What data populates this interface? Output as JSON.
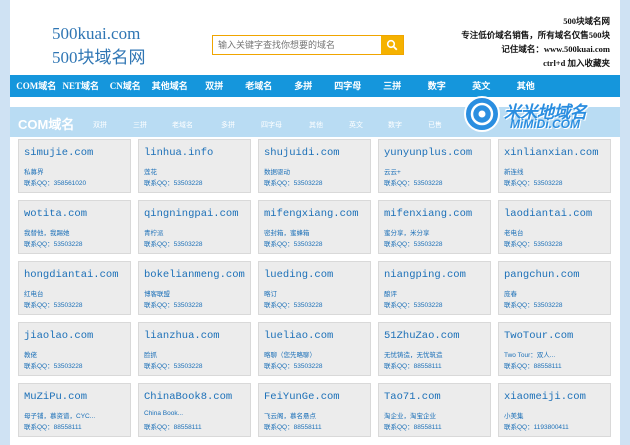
{
  "header": {
    "logo_en": "500kuai.com",
    "logo_cn": "500块域名网",
    "search_placeholder": "输入关键字查找你想要的域名",
    "info_lines": [
      "500块域名网",
      "专注低价域名销售，所有域名仅售500块",
      "记住域名：www.500kuai.com",
      "ctrl+d 加入收藏夹"
    ]
  },
  "nav": [
    "COM域名",
    "NET域名",
    "CN域名",
    "其他域名",
    "双拼",
    "老域名",
    "多拼",
    "四字母",
    "三拼",
    "数字",
    "英文",
    "其他"
  ],
  "category": {
    "title": "COM域名",
    "links": [
      "双拼",
      "三拼",
      "老域名",
      "多拼",
      "四字母",
      "其他",
      "英文",
      "数字",
      "已售"
    ]
  },
  "watermark": {
    "cn": "米米地域名",
    "en": "MiMiDi.COM"
  },
  "domains": [
    {
      "name": "simujie.com",
      "desc": "私募界",
      "qq": "联系QQ：358561020"
    },
    {
      "name": "linhua.info",
      "desc": "莲花",
      "qq": "联系QQ：53503228"
    },
    {
      "name": "shujuidi.com",
      "desc": "数据驱动",
      "qq": "联系QQ：53503228"
    },
    {
      "name": "yunyunplus.com",
      "desc": "云云+",
      "qq": "联系QQ：53503228"
    },
    {
      "name": "xinlianxian.com",
      "desc": "新连线",
      "qq": "联系QQ：53503228"
    },
    {
      "name": "wotita.com",
      "desc": "我替他，我踢她",
      "qq": "联系QQ：53503228"
    },
    {
      "name": "qingningpai.com",
      "desc": "青柠派",
      "qq": "联系QQ：53503228"
    },
    {
      "name": "mifengxiang.com",
      "desc": "密封箱，蜜蜂箱",
      "qq": "联系QQ：53503228"
    },
    {
      "name": "mifenxiang.com",
      "desc": "蜜分享，米分享",
      "qq": "联系QQ：53503228"
    },
    {
      "name": "laodiantai.com",
      "desc": "老电台",
      "qq": "联系QQ：53503228"
    },
    {
      "name": "hongdiantai.com",
      "desc": "红电台",
      "qq": "联系QQ：53503228"
    },
    {
      "name": "bokelianmeng.com",
      "desc": "博客联盟",
      "qq": "联系QQ：53503228"
    },
    {
      "name": "lueding.com",
      "desc": "略订",
      "qq": "联系QQ：53503228"
    },
    {
      "name": "niangping.com",
      "desc": "酿评",
      "qq": "联系QQ：53503228"
    },
    {
      "name": "pangchun.com",
      "desc": "庞春",
      "qq": "联系QQ：53503228"
    },
    {
      "name": "jiaolao.com",
      "desc": "教佬",
      "qq": "联系QQ：53503228"
    },
    {
      "name": "lianzhua.com",
      "desc": "脸抓",
      "qq": "联系QQ：53503228"
    },
    {
      "name": "lueliao.com",
      "desc": "略聊（您先略聊）",
      "qq": "联系QQ：53503228"
    },
    {
      "name": "51ZhuZao.com",
      "desc": "无忧铸造，无忧筑造",
      "qq": "联系QQ：88558111"
    },
    {
      "name": "TwoTour.com",
      "desc": "Two Tour：双人...",
      "qq": "联系QQ：88558111"
    },
    {
      "name": "MuZiPu.com",
      "desc": "母子铺，慕资谱，CYC...",
      "qq": "联系QQ：88558111"
    },
    {
      "name": "ChinaBook8.com",
      "desc": "China Book...",
      "qq": "联系QQ：88558111"
    },
    {
      "name": "FeiYunGe.com",
      "desc": "飞云阁，慕名悬点",
      "qq": "联系QQ：88558111"
    },
    {
      "name": "Tao71.com",
      "desc": "淘企业，淘宝企业",
      "qq": "联系QQ：88558111"
    },
    {
      "name": "xiaomeiji.com",
      "desc": "小美集",
      "qq": "联系QQ：1193800411"
    }
  ],
  "colors": {
    "nav_bg": "#1596dc",
    "link": "#1c70b8",
    "category_bg": "#b9dcf3",
    "page_bg": "#cfe2f3",
    "search_btn": "#f5b200"
  }
}
